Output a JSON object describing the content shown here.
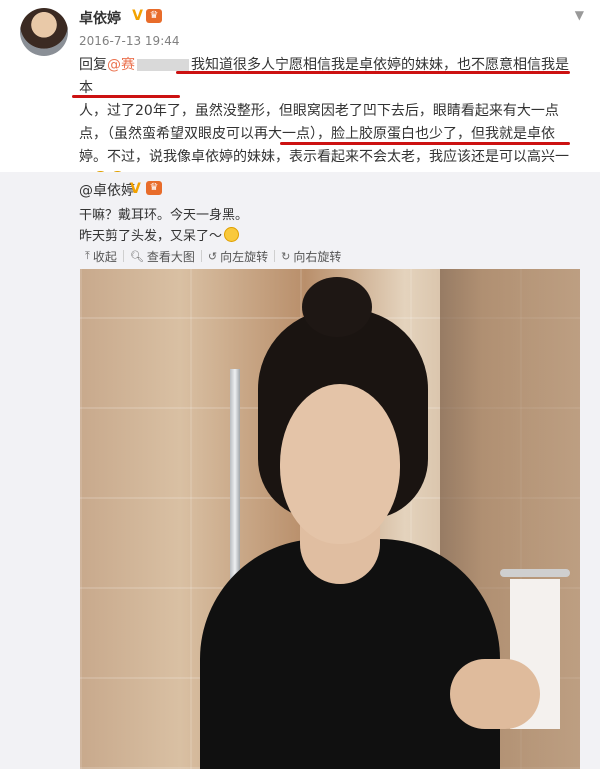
{
  "post": {
    "username": "卓依婷",
    "timestamp": "2016-7-13 19:44",
    "reply_prefix": "回复",
    "reply_mention": "@赛",
    "reply_line1": "我知道很多人宁愿相信我是卓依婷的妹妹，也不愿意相信我是本",
    "reply_line2": "人，过了20年了，虽然没整形，但眼窝因老了凹下去后，眼睛看起来有大一点",
    "reply_line3": "点，（虽然蛮希望双眼皮可以再大一点），脸上胶原蛋白也少了，但我就是卓依",
    "reply_line4": "婷。不过，说我像卓依婷的妹妹，表示看起来不会太老，我应该还是可以高兴一",
    "reply_line5": "下"
  },
  "repost": {
    "author": "@卓依婷",
    "line1": "干嘛？戴耳环。今天一身黑。",
    "line2": "昨天剪了头发，又呆了～",
    "toolbar": {
      "collapse": "收起",
      "view_large": "查看大图",
      "rotate_left": "向左旋转",
      "rotate_right": "向右旋转"
    }
  },
  "colors": {
    "mention": "#eb7350",
    "underline": "#cc1111",
    "repost_bg": "#f2f2f5"
  }
}
